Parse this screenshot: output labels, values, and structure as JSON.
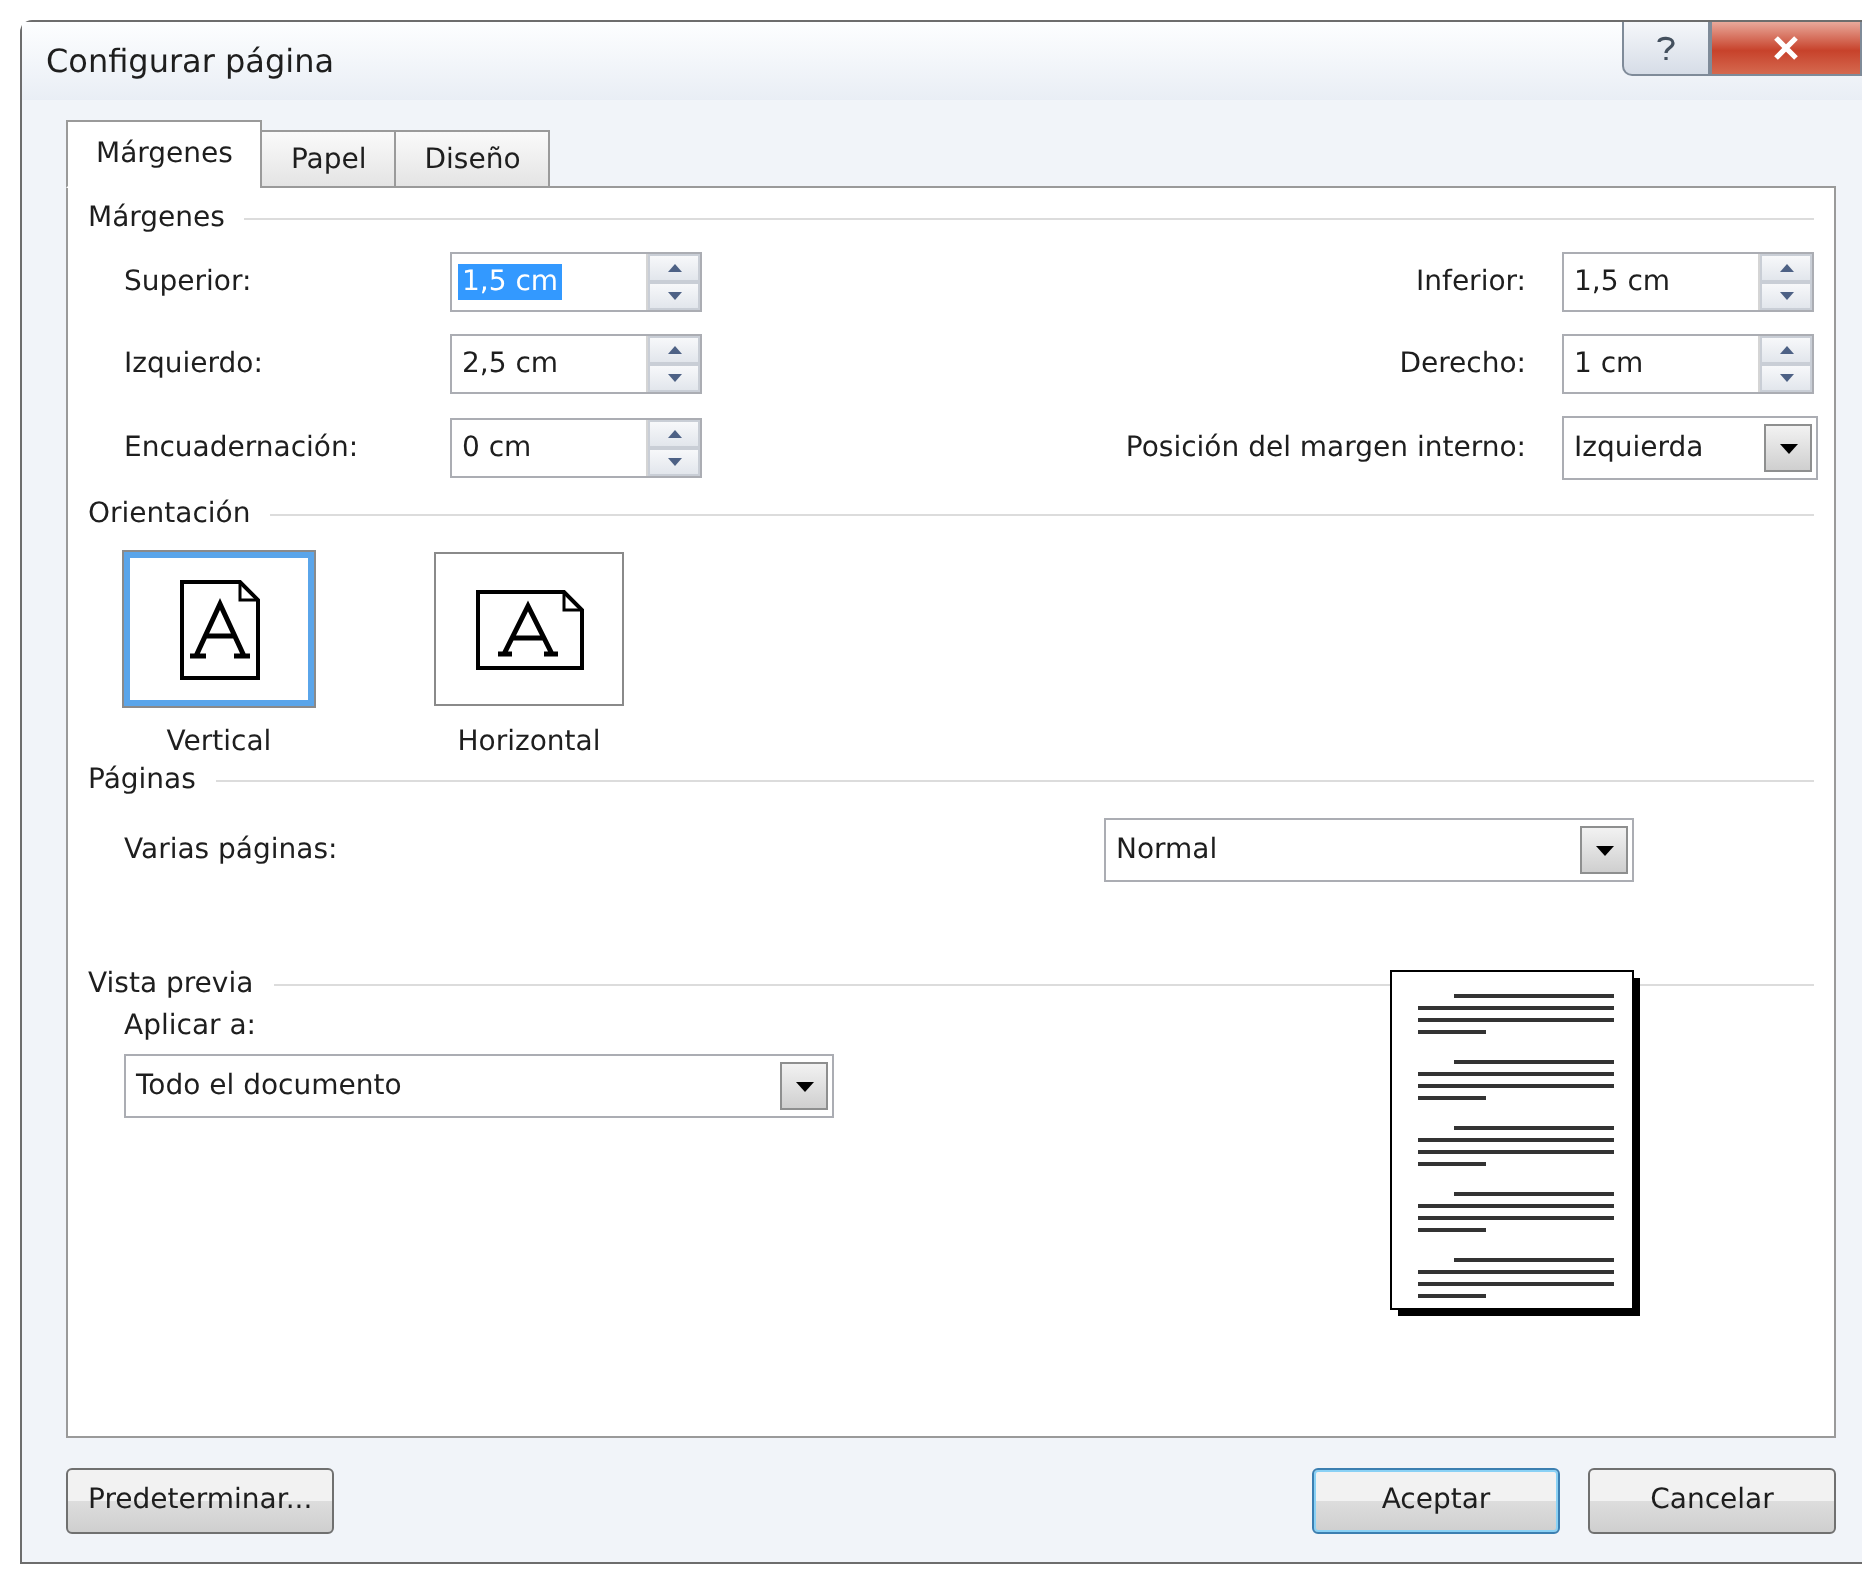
{
  "window": {
    "title": "Configurar página"
  },
  "tabs": [
    {
      "label": "Márgenes",
      "selected": true
    },
    {
      "label": "Papel",
      "selected": false
    },
    {
      "label": "Diseño",
      "selected": false
    }
  ],
  "margins": {
    "title": "Márgenes",
    "fields": [
      {
        "label": "Superior:",
        "kind": "spin",
        "value": "1,5 cm",
        "highlighted": true
      },
      {
        "label": "Inferior:",
        "kind": "spin",
        "value": "1,5 cm"
      },
      {
        "label": "Izquierdo:",
        "kind": "spin",
        "value": "2,5 cm"
      },
      {
        "label": "Derecho:",
        "kind": "spin",
        "value": "1 cm"
      },
      {
        "label": "Encuadernación:",
        "kind": "spin",
        "value": "0 cm"
      },
      {
        "label": "Posición del margen interno:",
        "kind": "dropdown",
        "value": "Izquierda"
      }
    ]
  },
  "orientation": {
    "title": "Orientación",
    "options": [
      {
        "label": "Vertical",
        "kind": "portrait",
        "selected": true
      },
      {
        "label": "Horizontal",
        "kind": "landscape",
        "selected": false
      }
    ]
  },
  "pages": {
    "title": "Páginas",
    "label": "Varias páginas:",
    "value": "Normal"
  },
  "preview": {
    "title": "Vista previa",
    "apply_label": "Aplicar a:",
    "apply_value": "Todo el documento"
  },
  "buttons": [
    {
      "label": "Predeterminar...",
      "default": false
    },
    {
      "label": "Aceptar",
      "default": true
    },
    {
      "label": "Cancelar",
      "default": false
    }
  ]
}
